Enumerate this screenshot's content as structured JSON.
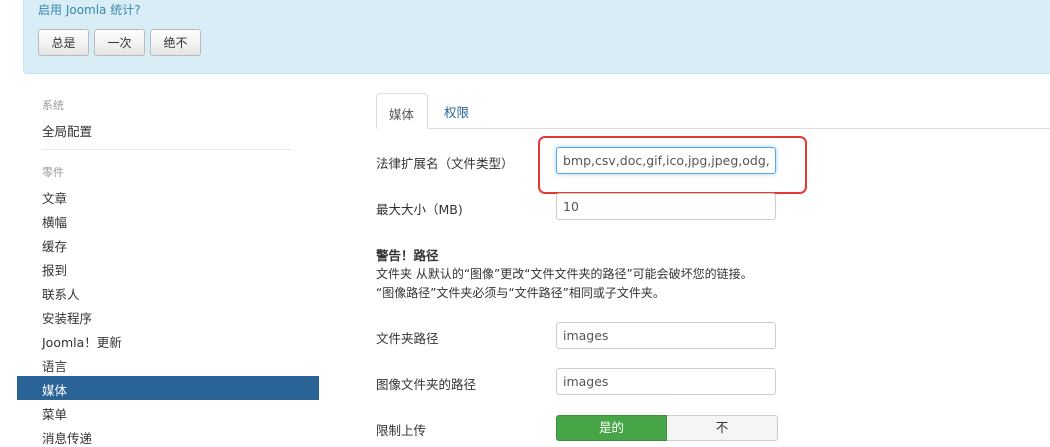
{
  "stats": {
    "question": "启用 Joomla 统计?",
    "buttons": [
      "总是",
      "一次",
      "绝不"
    ]
  },
  "sidebar": {
    "system_header": "系统",
    "system_items": [
      "全局配置"
    ],
    "components_header": "零件",
    "component_items": [
      "文章",
      "横幅",
      "缓存",
      "报到",
      "联系人",
      "安装程序",
      "Joomla！更新",
      "语言",
      "媒体",
      "菜单",
      "消息传递"
    ],
    "active_item": "媒体"
  },
  "tabs": [
    "媒体",
    "权限"
  ],
  "form": {
    "legal_extensions": {
      "label": "法律扩展名（文件类型）",
      "value": "bmp,csv,doc,gif,ico,jpg,jpeg,odg,odp,ods,odt,pdf,png,ppt,txt,xcf,xls"
    },
    "max_size": {
      "label": "最大大小（MB)",
      "value": "10"
    },
    "warning": {
      "title": "警告！路径",
      "line1": "文件夹 从默认的“图像”更改“文件文件夹的路径”可能会破坏您的链接。",
      "line2": "“图像路径”文件夹必须与“文件路径”相同或子文件夹。"
    },
    "file_path": {
      "label": "文件夹路径",
      "value": "images"
    },
    "image_path": {
      "label": "图像文件夹的路径",
      "value": "images"
    },
    "restrict_uploads": {
      "label": "限制上传",
      "yes": "是的",
      "no": "不"
    }
  },
  "colors": {
    "alert_bg": "#d9edf7",
    "active_sidebar": "#2a6496",
    "toggle_yes": "#46a546",
    "highlight_border": "#e53935"
  }
}
